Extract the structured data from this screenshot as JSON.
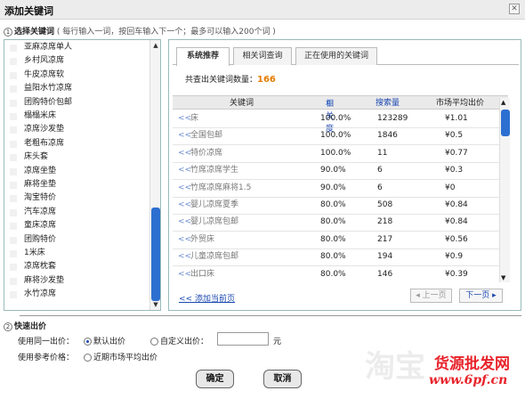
{
  "title": "添加关键词",
  "close_label": "✕",
  "step1": {
    "num": "1",
    "label": "选择关键词",
    "hint": "( 每行输入一词，按回车输入下一个；最多可以输入200个词 )"
  },
  "left_list": [
    "亚麻凉席单人",
    "乡村风凉席",
    "牛皮凉席软",
    "益阳水竹凉席",
    "团购特价包邮",
    "榻榻米床",
    "凉席沙发垫",
    "老粗布凉席",
    "床头套",
    "凉席坐垫",
    "麻将坐垫",
    "淘宝特价",
    "汽车凉席",
    "童床凉席",
    "团购特价",
    "1米床",
    "凉席枕套",
    "麻将沙发垫",
    "水竹凉席"
  ],
  "tabs": [
    "系统推荐",
    "相关词查询",
    "正在使用的关键词"
  ],
  "count": {
    "label": "共查出关键词数量：",
    "value": "166"
  },
  "table": {
    "headers": [
      "关键词",
      "相关度",
      "搜索量",
      "市场平均出价"
    ],
    "sort_icon": "⇩",
    "rows": [
      {
        "kw": "床",
        "rel": "100.0%",
        "vol": "123289",
        "price": "¥1.01"
      },
      {
        "kw": "全国包邮",
        "rel": "100.0%",
        "vol": "1846",
        "price": "¥0.5"
      },
      {
        "kw": "特价凉席",
        "rel": "100.0%",
        "vol": "11",
        "price": "¥0.77"
      },
      {
        "kw": "竹席凉席学生",
        "rel": "90.0%",
        "vol": "6",
        "price": "¥0.3"
      },
      {
        "kw": "竹席凉席麻将1.5",
        "rel": "90.0%",
        "vol": "6",
        "price": "¥0"
      },
      {
        "kw": "婴儿凉席夏季",
        "rel": "80.0%",
        "vol": "508",
        "price": "¥0.84"
      },
      {
        "kw": "婴儿凉席包邮",
        "rel": "80.0%",
        "vol": "218",
        "price": "¥0.84"
      },
      {
        "kw": "外贸床",
        "rel": "80.0%",
        "vol": "217",
        "price": "¥0.56"
      },
      {
        "kw": "儿童凉席包邮",
        "rel": "80.0%",
        "vol": "194",
        "price": "¥0.9"
      },
      {
        "kw": "出口床",
        "rel": "80.0%",
        "vol": "146",
        "price": "¥0.39"
      }
    ]
  },
  "add_all": "<< 添加当前页",
  "pager": {
    "prev": "◂ 上一页",
    "next": "下一页 ▸"
  },
  "step2": {
    "num": "2",
    "label": "快速出价"
  },
  "bid": {
    "same_label": "使用同一出价：",
    "default": "默认出价",
    "custom": "自定义出价：",
    "unit": "元",
    "ref_label": "使用参考价格：",
    "recent": "近期市场平均出价"
  },
  "buttons": {
    "ok": "确定",
    "cancel": "取消"
  },
  "watermark": {
    "text": "淘宝",
    "brand": "货源批发网",
    "url": "www.6pf.cn"
  },
  "colors": {
    "accent": "#2c6fd1",
    "count": "#e47b00",
    "brand_red": "#e8232a"
  }
}
